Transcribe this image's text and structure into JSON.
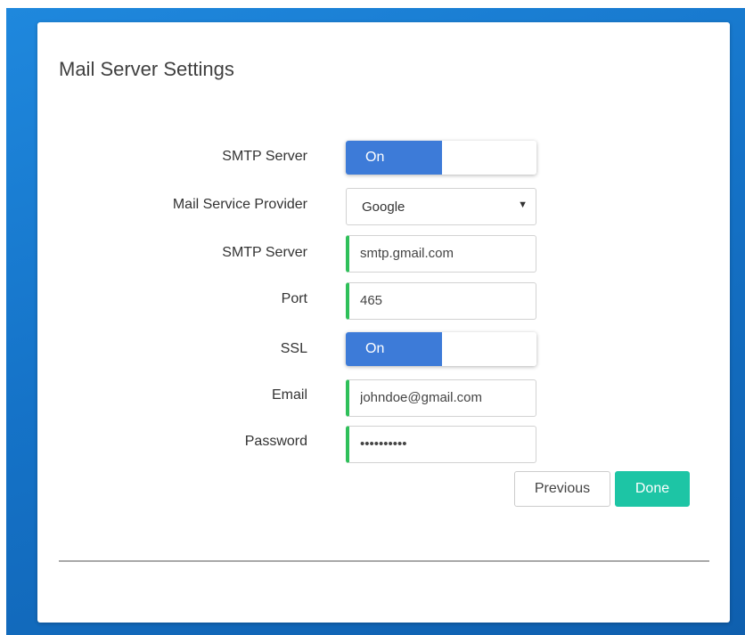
{
  "dialog": {
    "title": "Mail Server Settings"
  },
  "form": {
    "smtp_server_toggle": {
      "label": "SMTP Server",
      "state": "On"
    },
    "provider": {
      "label": "Mail Service Provider",
      "value": "Google"
    },
    "smtp_host": {
      "label": "SMTP Server",
      "value": "smtp.gmail.com"
    },
    "port": {
      "label": "Port",
      "value": "465"
    },
    "ssl_toggle": {
      "label": "SSL",
      "state": "On"
    },
    "email": {
      "label": "Email",
      "value": "johndoe@gmail.com"
    },
    "password": {
      "label": "Password",
      "value": "••••••••••"
    }
  },
  "buttons": {
    "previous": "Previous",
    "done": "Done"
  },
  "colors": {
    "toggle_on": "#3d7bd8",
    "valid_field_accent": "#2fc05a",
    "done_button": "#1dc5a5",
    "desktop_background": "#1573c8"
  },
  "icons": {
    "select_caret": "▼"
  }
}
